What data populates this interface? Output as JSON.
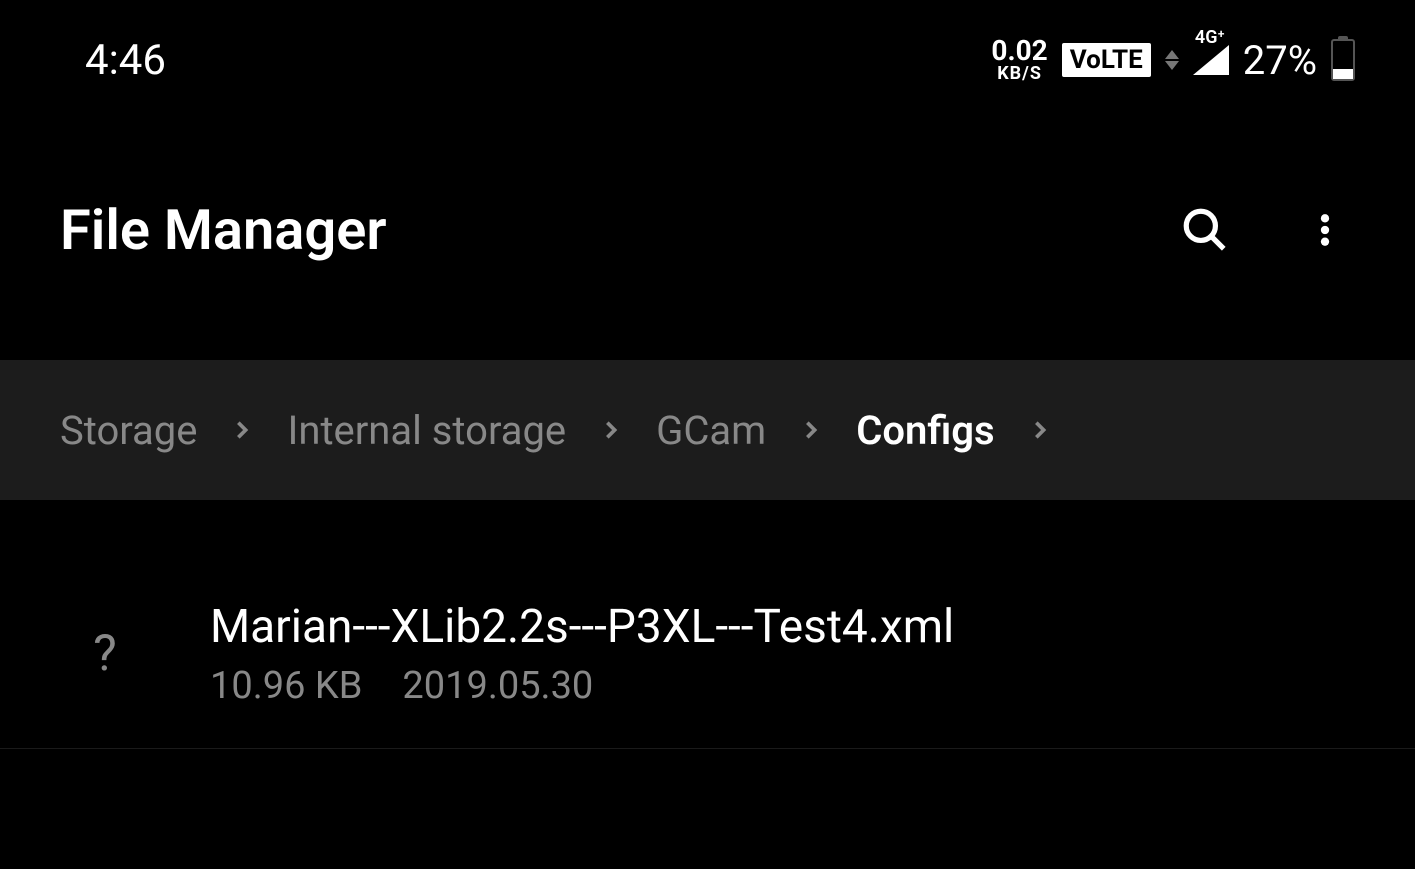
{
  "status": {
    "time": "4:46",
    "net_speed_value": "0.02",
    "net_speed_unit": "KB/S",
    "volte": "VoLTE",
    "network_label": "4G⁺",
    "battery_pct": "27%"
  },
  "header": {
    "title": "File Manager"
  },
  "breadcrumb": {
    "items": [
      {
        "label": "Storage",
        "active": false
      },
      {
        "label": "Internal storage",
        "active": false
      },
      {
        "label": "GCam",
        "active": false
      },
      {
        "label": "Configs",
        "active": true
      }
    ]
  },
  "files": [
    {
      "icon_glyph": "?",
      "name": "Marian---XLib2.2s---P3XL---Test4.xml",
      "size": "10.96 KB",
      "date": "2019.05.30"
    }
  ]
}
